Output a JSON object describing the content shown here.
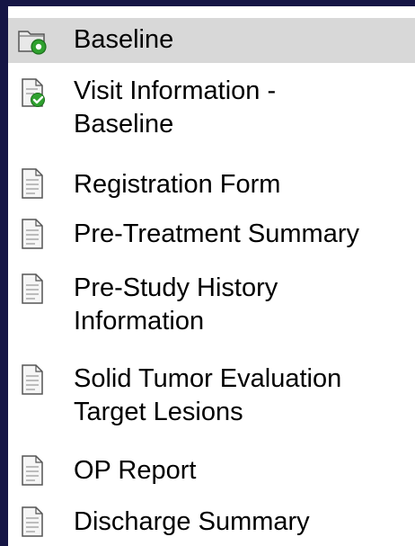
{
  "tree": {
    "items": [
      {
        "icon": "folder-icon",
        "lines": [
          "Baseline"
        ],
        "selected": true
      },
      {
        "icon": "checked-document-icon",
        "lines": [
          "Visit Information -",
          "Baseline"
        ],
        "selected": false
      },
      {
        "icon": "document-icon",
        "lines": [
          "Registration Form"
        ],
        "selected": false
      },
      {
        "icon": "document-icon",
        "lines": [
          "Pre-Treatment Summary"
        ],
        "selected": false
      },
      {
        "icon": "document-icon",
        "lines": [
          "Pre-Study History",
          "Information"
        ],
        "selected": false
      },
      {
        "icon": "document-icon",
        "lines": [
          "Solid Tumor Evaluation",
          "Target Lesions"
        ],
        "selected": false
      },
      {
        "icon": "document-icon",
        "lines": [
          "OP Report"
        ],
        "selected": false
      },
      {
        "icon": "document-icon",
        "lines": [
          "Discharge Summary"
        ],
        "selected": false
      }
    ]
  },
  "colors": {
    "frame": "#151545",
    "selection": "#d8d8d8",
    "folder_green": "#2fa12f"
  }
}
